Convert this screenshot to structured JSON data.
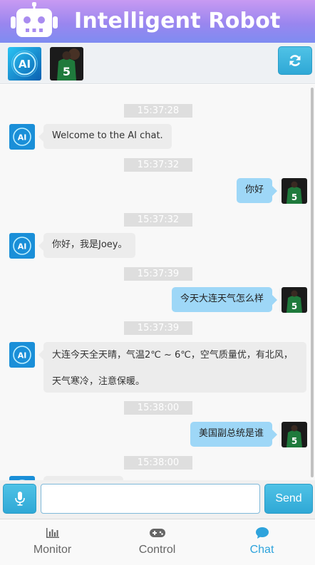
{
  "header": {
    "title": "Intelligent Robot",
    "logo_icon": "robot-icon"
  },
  "colors": {
    "header_gradient": [
      "#c89af2",
      "#7f8cf1"
    ],
    "button_blue": "#2fa8d6",
    "user_bubble": "#9ed7f7",
    "bot_bubble": "#ececec",
    "active_tab": "#2ea3dc"
  },
  "avatar_bar": {
    "bot_avatar": "ai-avatar",
    "user_avatar": "user-avatar-jersey-5",
    "refresh_icon": "refresh-icon"
  },
  "messages": [
    {
      "time": "15:37:28",
      "sender": "bot",
      "text": "Welcome to the AI chat."
    },
    {
      "time": "15:37:32",
      "sender": "user",
      "text": "你好"
    },
    {
      "time": "15:37:32",
      "sender": "bot",
      "text": "你好，我是Joey。"
    },
    {
      "time": "15:37:39",
      "sender": "user",
      "text": "今天大连天气怎么样"
    },
    {
      "time": "15:37:39",
      "sender": "bot",
      "text": "大连今天全天晴，气温2℃ ~ 6℃，空气质量优，有北风，天气寒冷，注意保暖。"
    },
    {
      "time": "15:38:00",
      "sender": "user",
      "text": "美国副总统是谁"
    },
    {
      "time": "15:38:00",
      "sender": "bot",
      "text": ""
    }
  ],
  "input": {
    "placeholder": "",
    "value": "",
    "mic_icon": "microphone-icon",
    "send_label": "Send"
  },
  "nav": {
    "items": [
      {
        "label": "Monitor",
        "icon": "bar-chart-icon",
        "active": false
      },
      {
        "label": "Control",
        "icon": "gamepad-icon",
        "active": false
      },
      {
        "label": "Chat",
        "icon": "chat-bubble-icon",
        "active": true
      }
    ]
  }
}
